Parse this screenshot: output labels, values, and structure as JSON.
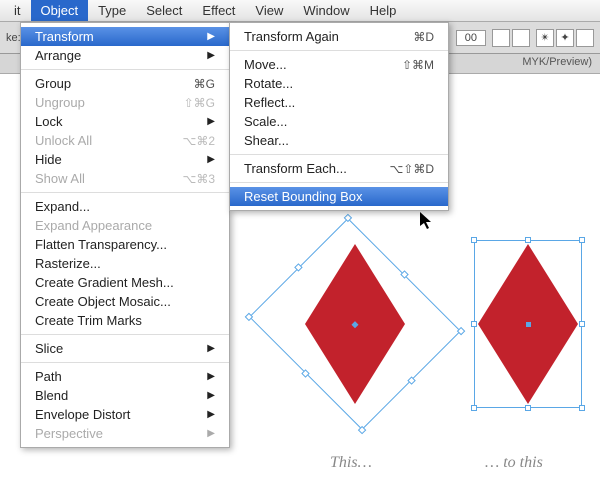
{
  "menubar": {
    "items": [
      {
        "label": "it",
        "active": false
      },
      {
        "label": "Object",
        "active": true
      },
      {
        "label": "Type",
        "active": false
      },
      {
        "label": "Select",
        "active": false
      },
      {
        "label": "Effect",
        "active": false
      },
      {
        "label": "View",
        "active": false
      },
      {
        "label": "Window",
        "active": false
      },
      {
        "label": "Help",
        "active": false
      }
    ]
  },
  "toolbar": {
    "label_ke": "ke:",
    "num": "00",
    "doc_tab": "MYK/Preview)"
  },
  "object_menu": {
    "transform": "Transform",
    "arrange": "Arrange",
    "group": "Group",
    "group_sc": "⌘G",
    "ungroup": "Ungroup",
    "ungroup_sc": "⇧⌘G",
    "lock": "Lock",
    "unlock": "Unlock All",
    "unlock_sc": "⌥⌘2",
    "hide": "Hide",
    "show": "Show All",
    "show_sc": "⌥⌘3",
    "expand": "Expand...",
    "expand_app": "Expand Appearance",
    "flatten": "Flatten Transparency...",
    "rasterize": "Rasterize...",
    "gradient": "Create Gradient Mesh...",
    "mosaic": "Create Object Mosaic...",
    "trim": "Create Trim Marks",
    "slice": "Slice",
    "path": "Path",
    "blend": "Blend",
    "envelope": "Envelope Distort",
    "perspective": "Perspective"
  },
  "transform_submenu": {
    "again": "Transform Again",
    "again_sc": "⌘D",
    "move": "Move...",
    "move_sc": "⇧⌘M",
    "rotate": "Rotate...",
    "reflect": "Reflect...",
    "scale": "Scale...",
    "shear": "Shear...",
    "each": "Transform Each...",
    "each_sc": "⌥⇧⌘D",
    "reset": "Reset Bounding Box"
  },
  "captions": {
    "left": "This…",
    "right": "… to this"
  }
}
